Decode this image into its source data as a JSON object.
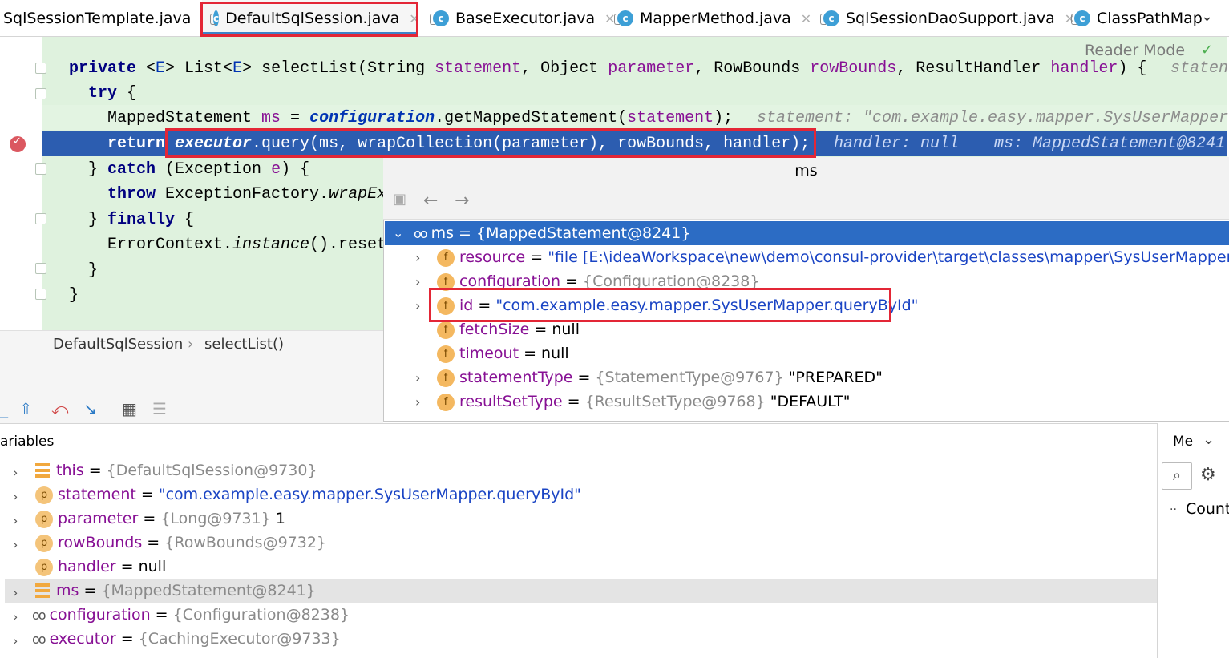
{
  "tabs": [
    {
      "label": "SqlSessionTemplate.java",
      "active": false
    },
    {
      "label": "DefaultSqlSession.java",
      "active": true
    },
    {
      "label": "BaseExecutor.java",
      "active": false
    },
    {
      "label": "MapperMethod.java",
      "active": false
    },
    {
      "label": "SqlSessionDaoSupport.java",
      "active": false
    },
    {
      "label": "ClassPathMap",
      "active": false
    }
  ],
  "editor": {
    "reader_mode": "Reader Mode",
    "code": {
      "l1": {
        "kw": "private",
        "a": " <",
        "gen": "E",
        "b": "> List<",
        "gen2": "E",
        "c": "> selectList(String ",
        "p1": "statement",
        "d": ", Object ",
        "p2": "parameter",
        "e": ", RowBounds ",
        "p3": "rowBounds",
        "f": ", ResultHandler ",
        "p4": "handler",
        "g": ") {",
        "hint": "staten"
      },
      "l2": {
        "kw": "try",
        "rest": " {"
      },
      "l3": {
        "a": "MappedStatement ",
        "var": "ms",
        "b": " = ",
        "cfg": "configuration",
        "c": ".getMappedStatement(",
        "p": "statement",
        "d": ");",
        "hint": "statement: \"com.example.easy.mapper.SysUserMapper"
      },
      "l4": {
        "kw": "return",
        "exec": "executor",
        "rest": ".query(ms, wrapCollection(parameter), rowBounds, handler);",
        "hint1": "handler: null",
        "hint2": "ms: MappedStatement@8241"
      },
      "l5": {
        "a": "} ",
        "kw": "catch",
        "b": " (Exception ",
        "var": "e",
        "c": ") {"
      },
      "l6": {
        "kw": "throw",
        "a": " ExceptionFactory.",
        "m": "wrapEx"
      },
      "l7": {
        "a": "} ",
        "kw": "finally",
        "b": " {"
      },
      "l8": {
        "a": "ErrorContext.",
        "m": "instance",
        "b": "().reset"
      },
      "l9": "}",
      "l10": "}"
    }
  },
  "breadcrumb": {
    "class": "DefaultSqlSession",
    "sep": "›",
    "method": "selectList()"
  },
  "popup": {
    "title": "ms",
    "root": {
      "name": "ms",
      "value": "{MappedStatement@8241}"
    },
    "fields": [
      {
        "name": "resource",
        "eq": " = ",
        "value": "\"file [E:\\ideaWorkspace\\new\\demo\\consul-provider\\target\\classes\\mapper\\SysUserMapper.xml]\"",
        "expandable": true
      },
      {
        "name": "configuration",
        "eq": " = ",
        "value": "{Configuration@8238}",
        "expandable": true
      },
      {
        "name": "id",
        "eq": " = ",
        "value": "\"com.example.easy.mapper.SysUserMapper.queryById\"",
        "expandable": true
      },
      {
        "name": "fetchSize",
        "eq": " = ",
        "value": "null",
        "expandable": false
      },
      {
        "name": "timeout",
        "eq": " = ",
        "value": "null",
        "expandable": false
      },
      {
        "name": "statementType",
        "eq": " = ",
        "value": "{StatementType@9767}",
        "extra": " \"PREPARED\"",
        "expandable": true
      },
      {
        "name": "resultSetType",
        "eq": " = ",
        "value": "{ResultSetType@9768}",
        "extra": " \"DEFAULT\"",
        "expandable": true
      }
    ]
  },
  "variables": {
    "label": "ariables",
    "items": [
      {
        "icon": "list",
        "name": "this",
        "eq": " = ",
        "value": "{DefaultSqlSession@9730}",
        "expandable": true
      },
      {
        "icon": "p",
        "name": "statement",
        "eq": " = ",
        "value": "\"com.example.easy.mapper.SysUserMapper.queryById\"",
        "expandable": true
      },
      {
        "icon": "p",
        "name": "parameter",
        "eq": " = ",
        "value": "{Long@9731}",
        "extra": " 1",
        "expandable": true
      },
      {
        "icon": "p",
        "name": "rowBounds",
        "eq": " = ",
        "value": "{RowBounds@9732}",
        "expandable": true
      },
      {
        "icon": "p",
        "name": "handler",
        "eq": " = ",
        "value": "null",
        "expandable": false
      },
      {
        "icon": "list",
        "name": "ms",
        "eq": " = ",
        "value": "{MappedStatement@8241}",
        "expandable": true
      },
      {
        "icon": "oo",
        "name": "configuration",
        "eq": " = ",
        "value": "{Configuration@8238}",
        "expandable": true
      },
      {
        "icon": "oo",
        "name": "executor",
        "eq": " = ",
        "value": "{CachingExecutor@9733}",
        "expandable": true
      }
    ]
  },
  "right_panel": {
    "label": "Me",
    "count": "Count",
    "dots": ".."
  },
  "colors": {
    "accent": "#2c6cc4",
    "highlight": "#e32636",
    "editor_bg": "#dff2de"
  }
}
